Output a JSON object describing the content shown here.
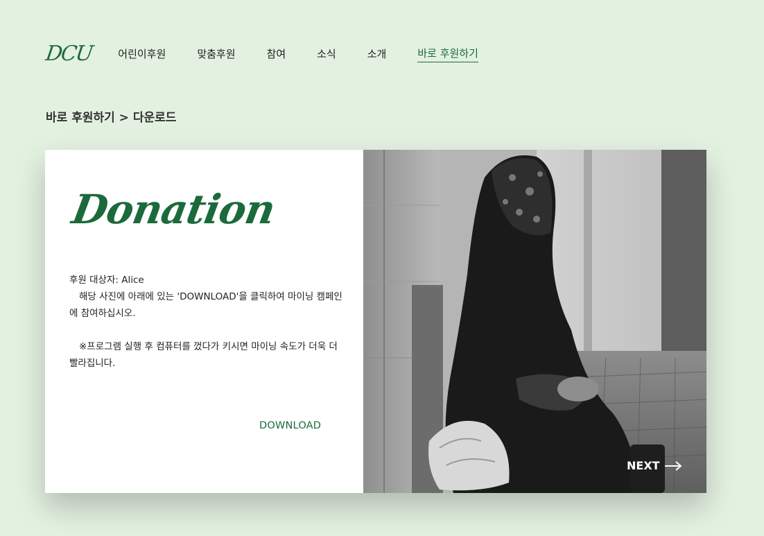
{
  "header": {
    "logo": "DCU",
    "nav": [
      {
        "label": "어린이후원"
      },
      {
        "label": "맞춤후원"
      },
      {
        "label": "참여"
      },
      {
        "label": "소식"
      },
      {
        "label": "소개"
      },
      {
        "label": "바로 후원하기",
        "active": true
      }
    ]
  },
  "breadcrumb": "바로 후원하기 > 다운로드",
  "card": {
    "title": "Donation",
    "description": {
      "line1": "후원 대상자: Alice",
      "line2": "해당 사진에 아래에 있는 'DOWNLOAD'을 클릭하여 마이닝 캠페인에 참여하십시오.",
      "line3": "※프로그램 실행 후 컴퓨터를 껐다가 키시면 마이닝 속도가 더욱 더 빨라집니다."
    },
    "download_label": "DOWNLOAD",
    "next_label": "NEXT"
  },
  "colors": {
    "accent": "#1c6a3c",
    "background": "#e3f1e1"
  }
}
